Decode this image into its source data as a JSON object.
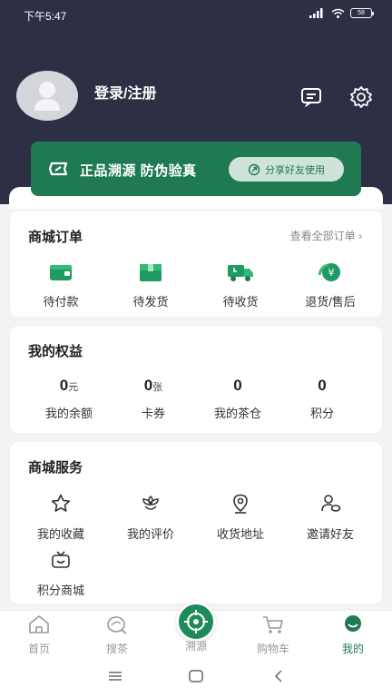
{
  "status": {
    "time": "下午5:47",
    "battery": "58"
  },
  "profile": {
    "login_label": "登录/注册",
    "message_icon": "message-icon",
    "settings_icon": "gear-icon"
  },
  "promo": {
    "title": "正品溯源  防伪验真",
    "share_label": "分享好友使用",
    "accent": "#1f7a52"
  },
  "orders": {
    "title": "商城订单",
    "view_all": "查看全部订单 ›",
    "items": [
      {
        "label": "待付款",
        "icon": "wallet-icon"
      },
      {
        "label": "待发货",
        "icon": "package-icon"
      },
      {
        "label": "待收货",
        "icon": "truck-icon"
      },
      {
        "label": "退货/售后",
        "icon": "refund-icon"
      }
    ]
  },
  "benefits": {
    "title": "我的权益",
    "items": [
      {
        "value": "0",
        "unit": "元",
        "label": "我的余额"
      },
      {
        "value": "0",
        "unit": "张",
        "label": "卡券"
      },
      {
        "value": "0",
        "unit": "",
        "label": "我的茶仓"
      },
      {
        "value": "0",
        "unit": "",
        "label": "积分"
      }
    ]
  },
  "services": {
    "title": "商城服务",
    "items": [
      {
        "label": "我的收藏",
        "icon": "star-icon"
      },
      {
        "label": "我的评价",
        "icon": "flower-icon"
      },
      {
        "label": "收货地址",
        "icon": "location-icon"
      },
      {
        "label": "邀请好友",
        "icon": "invite-icon"
      },
      {
        "label": "积分商城",
        "icon": "points-mall-icon"
      }
    ]
  },
  "tabbar": {
    "items": [
      {
        "label": "首页",
        "icon": "home-icon"
      },
      {
        "label": "搜茶",
        "icon": "search-tea-icon"
      },
      {
        "label": "溯源",
        "icon": "trace-icon"
      },
      {
        "label": "购物车",
        "icon": "cart-icon"
      },
      {
        "label": "我的",
        "icon": "profile-icon",
        "active": true
      }
    ]
  }
}
